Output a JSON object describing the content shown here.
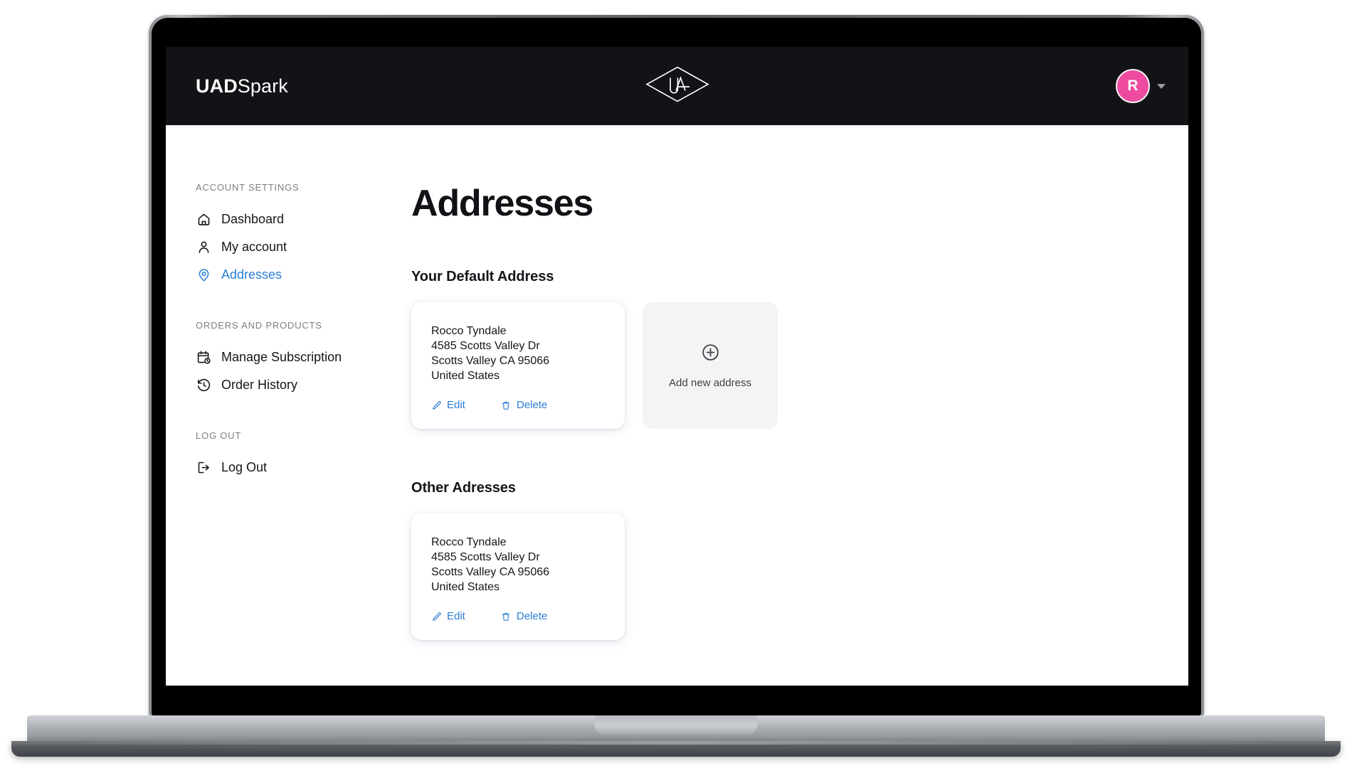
{
  "brand": {
    "bold": "UAD",
    "light": "Spark",
    "center_logo_icon": "universal-audio-diamond-logo"
  },
  "topnav": {
    "avatar_initial": "R",
    "avatar_color": "#ee4ba0",
    "caret_icon": "chevron-down-icon",
    "background": "#121316"
  },
  "sidebar": {
    "groups": [
      {
        "title": "ACCOUNT SETTINGS",
        "items": [
          {
            "label": "Dashboard",
            "icon": "home-icon",
            "active": false
          },
          {
            "label": "My account",
            "icon": "user-icon",
            "active": false
          },
          {
            "label": "Addresses",
            "icon": "map-pin-icon",
            "active": true
          }
        ]
      },
      {
        "title": "ORDERS AND PRODUCTS",
        "items": [
          {
            "label": "Manage Subscription",
            "icon": "calendar-clock-icon",
            "active": false
          },
          {
            "label": "Order History",
            "icon": "clock-history-icon",
            "active": false
          }
        ]
      },
      {
        "title": "LOG OUT",
        "items": [
          {
            "label": "Log Out",
            "icon": "logout-icon",
            "active": false
          }
        ]
      }
    ]
  },
  "main": {
    "page_title": "Addresses",
    "accent_link_color": "#2b7ed4",
    "default_section": {
      "title": "Your Default Address",
      "address": {
        "name": "Rocco Tyndale",
        "street": "4585 Scotts Valley Dr",
        "city_state_zip": "Scotts Valley CA 95066",
        "country": "United States",
        "edit_label": "Edit",
        "edit_icon": "pencil-icon",
        "delete_label": "Delete",
        "delete_icon": "trash-icon"
      },
      "add_card": {
        "label": "Add new address",
        "icon": "plus-circle-icon"
      }
    },
    "other_section": {
      "title": "Other Adresses",
      "address": {
        "name": "Rocco Tyndale",
        "street": "4585 Scotts Valley Dr",
        "city_state_zip": "Scotts Valley CA 95066",
        "country": "United States",
        "edit_label": "Edit",
        "edit_icon": "pencil-icon",
        "delete_label": "Delete",
        "delete_icon": "trash-icon"
      }
    }
  }
}
